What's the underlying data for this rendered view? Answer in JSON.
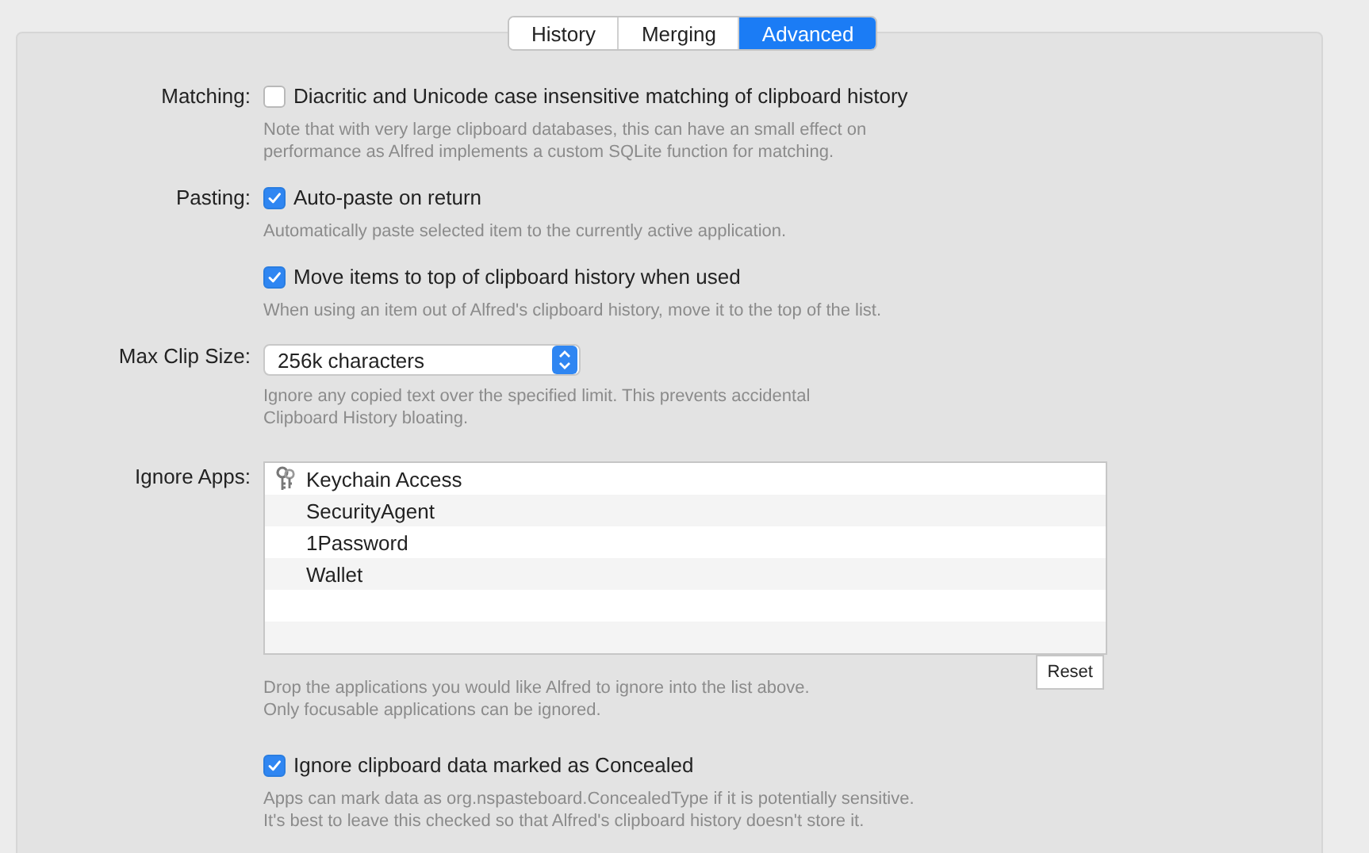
{
  "tabs": [
    {
      "label": "History",
      "selected": false
    },
    {
      "label": "Merging",
      "selected": false
    },
    {
      "label": "Advanced",
      "selected": true
    }
  ],
  "settings": [
    {
      "kind": "checkbox",
      "label": "Matching:",
      "text": "Diacritic and Unicode case insensitive matching of clipboard history",
      "checked": false,
      "note": [
        "Note that with very large clipboard databases, this can have an small effect on",
        "performance as Alfred implements a custom SQLite function for matching."
      ]
    },
    {
      "kind": "checkbox",
      "label": "Pasting:",
      "text": "Auto-paste on return",
      "checked": true,
      "note": [
        "Automatically paste selected item to the currently active application."
      ]
    },
    {
      "kind": "checkbox",
      "text": "Move items to top of clipboard history when used",
      "checked": true,
      "note": [
        "When using an item out of Alfred's clipboard history, move it to the top of the list."
      ]
    },
    {
      "kind": "select",
      "label": "Max Clip Size:",
      "value": "256k characters",
      "note": [
        "Ignore any copied text over the specified limit. This prevents accidental",
        "Clipboard History bloating."
      ]
    },
    {
      "kind": "list",
      "label": "Ignore Apps:",
      "items": [
        {
          "name": "Keychain Access",
          "has_icon": true
        },
        {
          "name": "SecurityAgent",
          "has_icon": false
        },
        {
          "name": "1Password",
          "has_icon": false
        },
        {
          "name": "Wallet",
          "has_icon": false
        }
      ],
      "button": "Reset",
      "note": [
        "Drop the applications you would like Alfred to ignore into the list above.",
        "Only focusable applications can be ignored."
      ]
    },
    {
      "kind": "checkbox",
      "text": "Ignore clipboard data marked as Concealed",
      "checked": true,
      "note": [
        "Apps can mark data as org.nspasteboard.ConcealedType if it is potentially sensitive.",
        "It's best to leave this checked so that Alfred's clipboard history doesn't store it."
      ]
    }
  ]
}
